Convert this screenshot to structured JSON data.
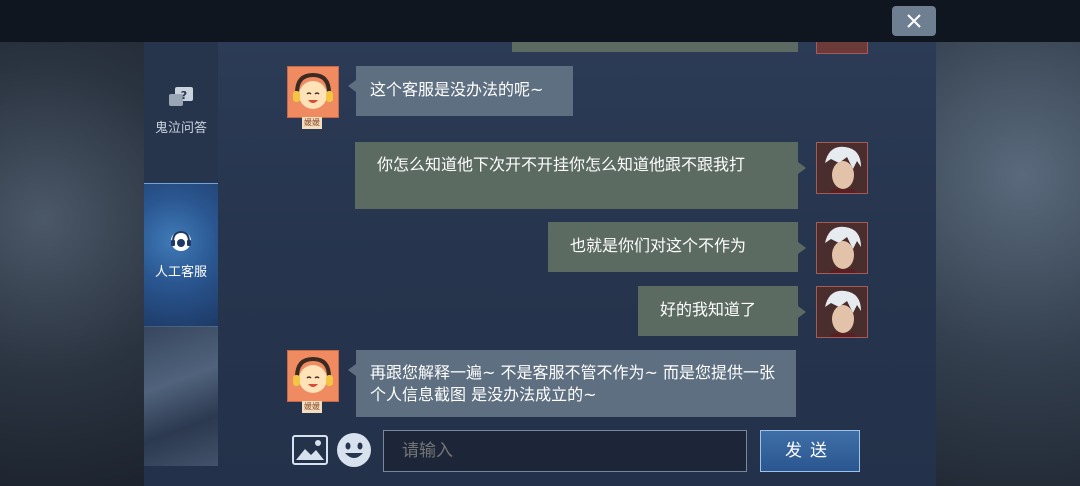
{
  "window": {
    "close_icon": "close-icon"
  },
  "sidebar": {
    "items": [
      {
        "label": "鬼泣问答",
        "icon": "faq-chat-icon",
        "active": false
      },
      {
        "label": "人工客服",
        "icon": "headset-icon",
        "active": true
      }
    ]
  },
  "chat": {
    "messages": [
      {
        "sender": "service",
        "avatar_tag": "媛媛",
        "text": "这个客服是没办法的呢~"
      },
      {
        "sender": "user",
        "text": "你怎么知道他下次开不开挂你怎么知道他跟不跟我打"
      },
      {
        "sender": "user",
        "text": "也就是你们对这个不作为"
      },
      {
        "sender": "user",
        "text": "好的我知道了"
      },
      {
        "sender": "service",
        "avatar_tag": "媛媛",
        "text": "再跟您解释一遍~ 不是客服不管不作为~ 而是您提供一张个人信息截图 是没办法成立的~"
      }
    ]
  },
  "input": {
    "placeholder": "请输入",
    "send_label": "发送",
    "image_icon": "image-icon",
    "emoji_icon": "emoji-icon"
  },
  "colors": {
    "panel": "#26344d",
    "service_bubble": "#5e6f81",
    "user_bubble": "#5c6b62",
    "active_tab": "#2a5690"
  }
}
